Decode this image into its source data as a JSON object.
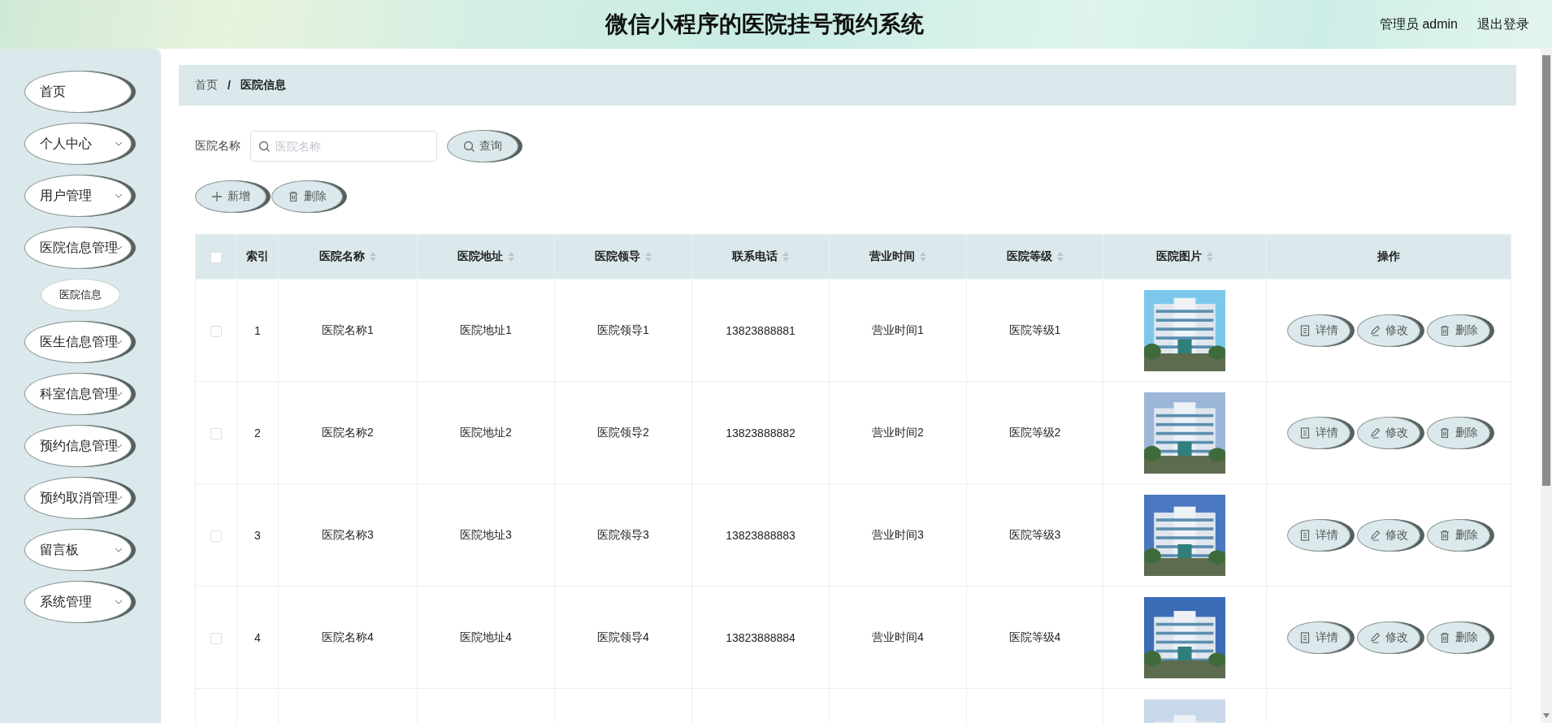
{
  "header": {
    "title": "微信小程序的医院挂号预约系统",
    "user": "管理员 admin",
    "logout": "退出登录"
  },
  "sidebar": {
    "items": [
      {
        "label": "首页",
        "kind": "link"
      },
      {
        "label": "个人中心",
        "kind": "submenu"
      },
      {
        "label": "用户管理",
        "kind": "submenu"
      },
      {
        "label": "医院信息管理",
        "kind": "submenu",
        "children": [
          {
            "label": "医院信息",
            "selected": true
          }
        ]
      },
      {
        "label": "医生信息管理",
        "kind": "submenu"
      },
      {
        "label": "科室信息管理",
        "kind": "submenu"
      },
      {
        "label": "预约信息管理",
        "kind": "submenu"
      },
      {
        "label": "预约取消管理",
        "kind": "submenu"
      },
      {
        "label": "留言板",
        "kind": "submenu"
      },
      {
        "label": "系统管理",
        "kind": "submenu"
      }
    ]
  },
  "breadcrumb": {
    "items": [
      "首页",
      "医院信息"
    ],
    "separator": "/"
  },
  "search": {
    "label": "医院名称",
    "placeholder": "医院名称",
    "button": "查询"
  },
  "actions": [
    {
      "label": "新增",
      "kind": "add"
    },
    {
      "label": "删除",
      "kind": "delete"
    }
  ],
  "table": {
    "select_all": false,
    "columns": [
      {
        "label": "索引",
        "sortable": false
      },
      {
        "label": "医院名称",
        "sortable": true
      },
      {
        "label": "医院地址",
        "sortable": true
      },
      {
        "label": "医院领导",
        "sortable": true
      },
      {
        "label": "联系电话",
        "sortable": true
      },
      {
        "label": "营业时间",
        "sortable": true
      },
      {
        "label": "医院等级",
        "sortable": true
      },
      {
        "label": "医院图片",
        "sortable": true
      },
      {
        "label": "操作",
        "sortable": false
      }
    ],
    "rows": [
      {
        "checked": false,
        "cells": [
          "1",
          "医院名称1",
          "医院地址1",
          "医院领导1",
          "13823888881",
          "营业时间1",
          "医院等级1"
        ],
        "image": {
          "kind": "picture"
        },
        "buttons": [
          {
            "label": "详情",
            "kind": "detail"
          },
          {
            "label": "修改",
            "kind": "edit"
          },
          {
            "label": "删除",
            "kind": "delete"
          }
        ]
      },
      {
        "checked": false,
        "cells": [
          "2",
          "医院名称2",
          "医院地址2",
          "医院领导2",
          "13823888882",
          "营业时间2",
          "医院等级2"
        ],
        "image": {
          "kind": "picture"
        },
        "buttons": [
          {
            "label": "详情",
            "kind": "detail"
          },
          {
            "label": "修改",
            "kind": "edit"
          },
          {
            "label": "删除",
            "kind": "delete"
          }
        ]
      },
      {
        "checked": false,
        "cells": [
          "3",
          "医院名称3",
          "医院地址3",
          "医院领导3",
          "13823888883",
          "营业时间3",
          "医院等级3"
        ],
        "image": {
          "kind": "picture"
        },
        "buttons": [
          {
            "label": "详情",
            "kind": "detail"
          },
          {
            "label": "修改",
            "kind": "edit"
          },
          {
            "label": "删除",
            "kind": "delete"
          }
        ]
      },
      {
        "checked": false,
        "cells": [
          "4",
          "医院名称4",
          "医院地址4",
          "医院领导4",
          "13823888884",
          "营业时间4",
          "医院等级4"
        ],
        "image": {
          "kind": "picture"
        },
        "buttons": [
          {
            "label": "详情",
            "kind": "detail"
          },
          {
            "label": "修改",
            "kind": "edit"
          },
          {
            "label": "删除",
            "kind": "delete"
          }
        ]
      },
      {
        "image": {
          "kind": "picture"
        }
      }
    ]
  }
}
